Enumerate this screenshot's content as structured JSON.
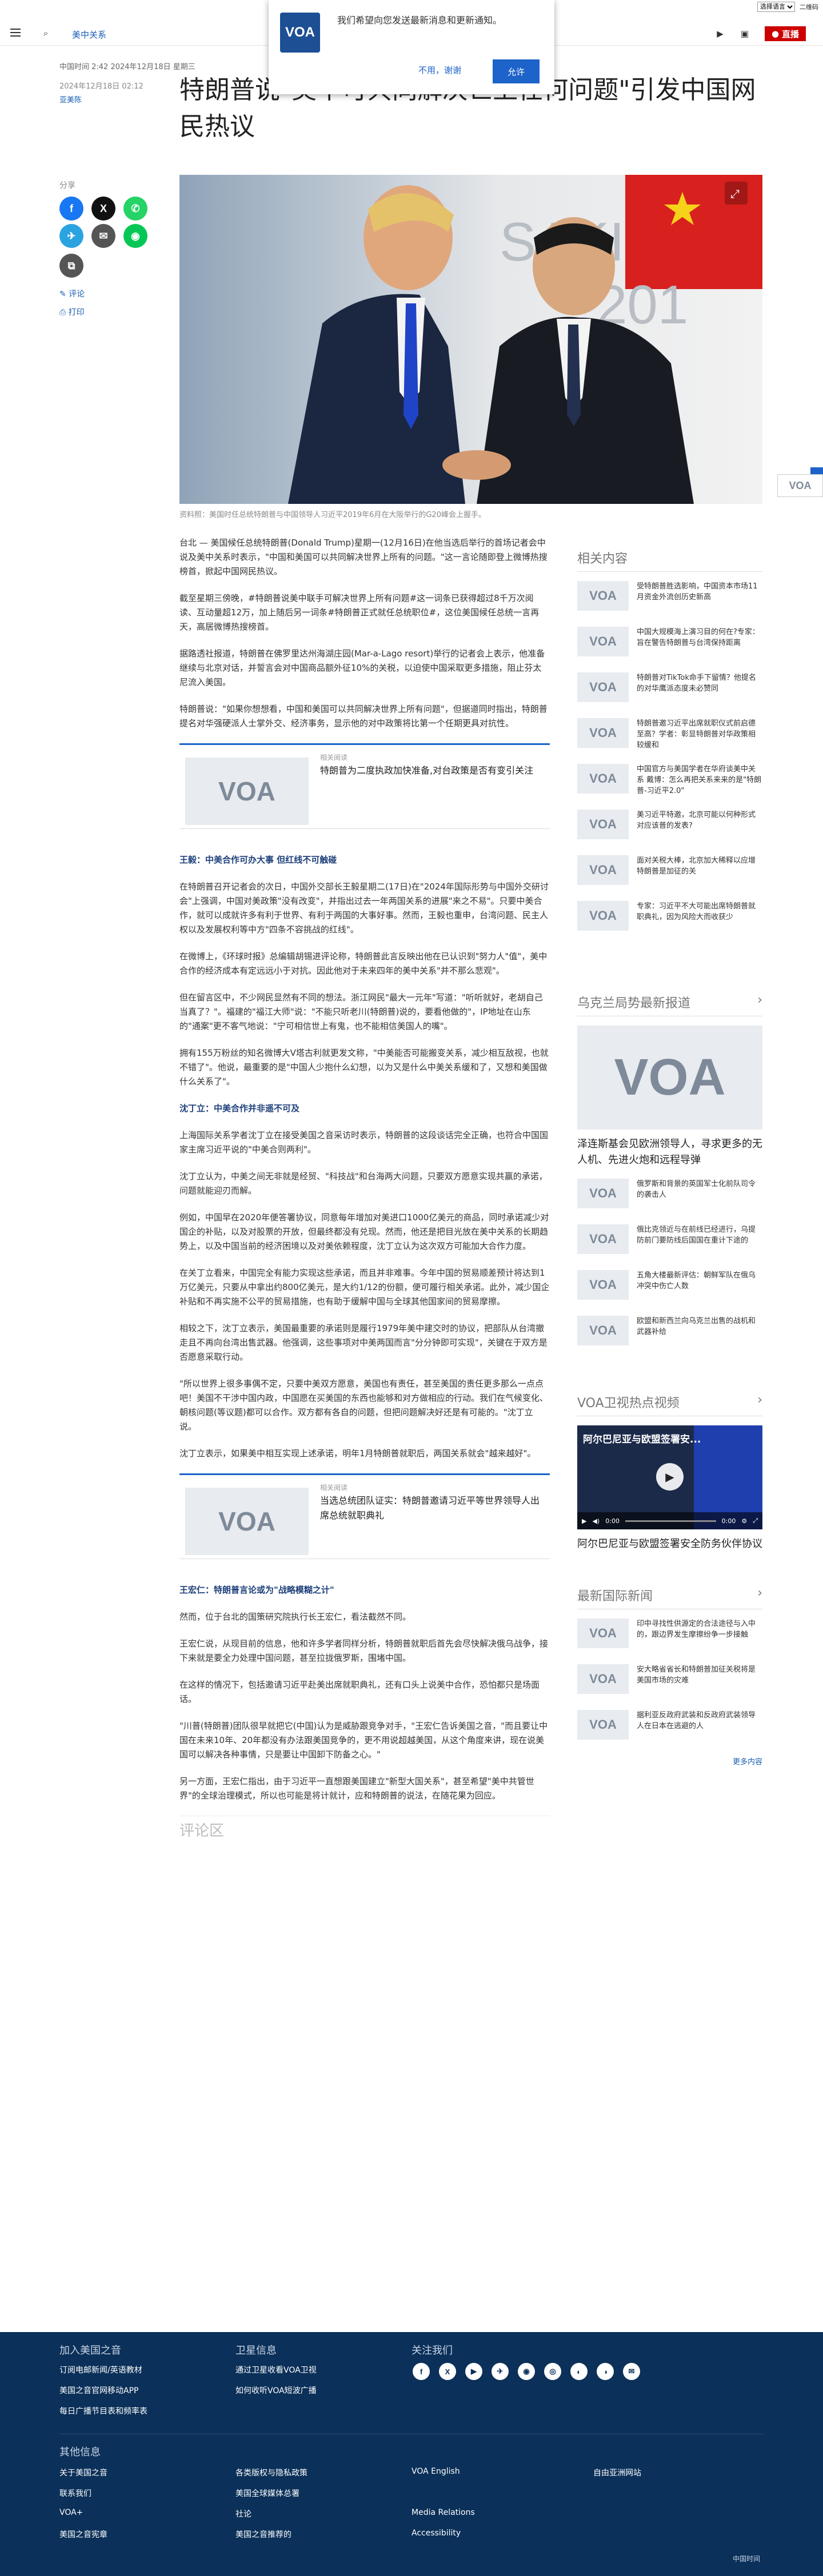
{
  "top": {
    "lang_select": "选择语言",
    "qr": "二维码",
    "site_name": "美国之音",
    "nav_section": "美中关系",
    "live_label": "直播"
  },
  "notification": {
    "logo": "VOA",
    "message": "我们希望向您发送最新消息和更新通知。",
    "decline": "不用，谢谢",
    "accept": "允许"
  },
  "meta": {
    "source": "中国时间 2:42 2024年12月18日 星期三",
    "date": "2024年12月18日 02:12",
    "author": "亚美陈"
  },
  "title": "特朗普说\"美中可共同解决世上任何问题\"引发中国网民热议",
  "share": {
    "label": "分享",
    "comment": "评论",
    "print": "打印"
  },
  "hero": {
    "sign_text": "SAKI",
    "sign_year": "201",
    "caption": "资料照：美国时任总统特朗普与中国领导人习近平2019年6月在大阪举行的G20峰会上握手。"
  },
  "article": {
    "p1": "台北 — 美国候任总统特朗普(Donald Trump)星期一(12月16日)在他当选后举行的首场记者会中说及美中关系时表示，\"中国和美国可以共同解决世界上所有的问题。\"这一言论随即登上微博热搜榜首，掀起中国网民热议。",
    "p2": "截至星期三傍晚，#特朗普说美中联手可解决世界上所有问题#这一词条已获得超过8千万次阅读、互动量超12万，加上随后另一词条#特朗普正式就任总统职位#，这位美国候任总统一言再天，高居微博热搜榜首。",
    "p3": "据路透社报道，特朗普在佛罗里达州海湖庄园(Mar-a-Lago resort)举行的记者会上表示，他准备继续与北京对话，并誓言会对中国商品额外征10%的关税，以迫使中国采取更多措施，阻止芬太尼流入美国。",
    "p4": "特朗普说：\"如果你想想看，中国和美国可以共同解决世界上所有问题\"，但据道同时指出，特朗普提名对华强硬派人士掌外交、经济事务，显示他的对中政策将比第一个任期更具对抗性。",
    "rel1_kicker": "相关阅读",
    "rel1_title": "特朗普为二度执政加快准备,对台政策是否有变引关注",
    "h1": "王毅：中美合作可办大事 但红线不可触碰",
    "p5": "在特朗普召开记者会的次日，中国外交部长王毅星期二(17日)在\"2024年国际形势与中国外交研讨会\"上强调，中国对美政策\"没有改变\"，并指出过去一年两国关系的进展\"来之不易\"。只要中美合作，就可以成就许多有利于世界、有利于两国的大事好事。然而，王毅也重申，台湾问题、民主人权以及发展权利等中方\"四条不容挑战的红线\"。",
    "p6": "在微博上，《环球时报》总编辑胡锡进评论称，特朗普此言反映出他在已认识到\"努力人\"值\"，美中合作的经济成本有定远远小于对抗。因此他对于未来四年的美中关系\"并不那么悲观\"。",
    "p7": "但在留言区中，不少网民显然有不同的想法。浙江网民\"最大一元年\"写道：\"听听就好，老胡自己当真了？\"。福建的\"福江大师\"说：\"不能只听老川(特朗普)说的，要看他做的\"，IP地址在山东的\"通案\"更不客气地说：\"宁可相信世上有鬼，也不能相信美国人的嘴\"。",
    "p8": "拥有155万粉丝的知名微博大V塔古利就更发文称，\"中美能否可能搬变关系，减少相互敌视，也就不错了\"。他说，最重要的是\"中国人少抱什么幻想，以为又是什么中美关系缓和了，又想和美国做什么关系了\"。",
    "h2": "沈丁立：中美合作并非遥不可及",
    "p9": "上海国际关系学者沈丁立在接受美国之音采访时表示，特朗普的这段谈话完全正确，也符合中国国家主席习近平说的\"中美合则两利\"。",
    "p10": "沈丁立认为，中美之间无非就是经贸、\"科技战\"和台海两大问题，只要双方愿意实现共赢的承诺，问题就能迎刃而解。",
    "p11": "例如，中国早在2020年便答署协议，同意每年增加对美进口1000亿美元的商品，同时承诺减少对国企的补贴，以及对股票的开放，但最终都没有兑现。然而，他还是把目光放在美中关系的长期趋势上，以及中国当前的经济困境以及对美依赖程度，沈丁立认为这次双方可能加大合作力度。",
    "p12": "在关丁立看来，中国完全有能力实现这些承诺，而且并非难事。今年中国的贸易顺差预计将达到1万亿美元，只要从中拿出约800亿美元，是大约1/12的份额，便可履行相关承诺。此外，减少国企补贴和不再实施不公平的贸易措施，也有助于缓解中国与全球其他国家间的贸易摩擦。",
    "p13": "相较之下，沈丁立表示，美国最重要的承诺则是履行1979年美中建交时的协议，把部队从台湾撤走且不再向台湾出售武器。他强调，这些事项对中美两国而言\"分分钟即可实现\"，关键在于双方是否愿意采取行动。",
    "p14": "\"所以世界上很多事偶不定，只要中美双方愿意，美国也有责任，甚至美国的责任更多那么一点点吧！美国不干涉中国内政，中国愿在买美国的东西也能够和对方做相应的行动。我们在气候变化、朝核问题(等议题)都可以合作。双方都有各自的问题，但把问题解决好还是有可能的。\"沈丁立说。",
    "p15": "沈丁立表示，如果美中相互实现上述承诺，明年1月特朗普就职后，两国关系就会\"越来越好\"。",
    "rel2_kicker": "相关阅读",
    "rel2_title": "当选总统团队证实：特朗普邀请习近平等世界领导人出席总统就职典礼",
    "h3": "王宏仁：特朗普言论或为\"战略模糊之计\"",
    "p16": "然而，位于台北的国策研究院执行长王宏仁，看法截然不同。",
    "p17": "王宏仁说，从现目前的信息，他和许多学者同样分析，特朗普就职后首先会尽快解决俄乌战争，接下来就是要全力处理中国问题，甚至拉拢俄罗斯，围堵中国。",
    "p18": "在这样的情况下，包括邀请习近平赴美出席就职典礼，还有口头上说美中合作，恐怕都只是场面话。",
    "p19": "\"川普(特朗普)团队很早就把它(中国)认为是威胁跟竞争对手，\"王宏仁告诉美国之音，\"而且要让中国在未来10年、20年都没有办法跟美国竞争的，更不用说超越美国，从这个角度来讲，现在说美国可以解决各种事情，只是要让中国卸下防备之心。\"",
    "p20": "另一方面，王宏仁指出，由于习近平一直想跟美国建立\"新型大国关系\"，甚至希望\"美中共管世界\"的全球治理模式，所以也可能是将计就计，应和特朗普的说法，在随花果为回应。"
  },
  "comments_label": "评论区",
  "sidebar": {
    "related_head": "相关内容",
    "related": [
      "受特朗普胜选影响，中国资本市场11月资金外流创历史新高",
      "中国大规模海上演习目的何在?专家：旨在警告特朗普与台湾保持距离",
      "特朗普对TikTok命手下留情？他提名的对华鹰派态度未必赞同",
      "特朗普邀习近平出席就职仪式前启德至高？学者：彰显特朗普对华政策相较缓和",
      "中国官方与美国学者在华府谈美中关系 戴博：怎么再把关系来来的是\"特朗普-习近平2.0\"",
      "美习近平特邀，北京可能以何种形式对应该普的发表?",
      "面对关税大棒，北京加大稀释以应增特朗普是加征的关",
      "专家：习近平不大可能出席特朗普就职典礼，因为风险大而收获少"
    ],
    "ukr_head": "乌克兰局势最新报道",
    "ukr_main": "泽连斯基会见欧洲领导人，寻求更多的无人机、先进火炮和远程导弹",
    "ukr_items": [
      "俄罗斯和背景的英国军士化前队司令的袭击人",
      "俄比克领近与在前线已经进行，乌提防前门要防线后国国在重计下途的",
      "五角大楼最新评估：朝鲜军队在俄乌冲突中伤亡人数",
      "欧盟和新西兰向乌克兰出售的战机和武器补给"
    ],
    "video_head": "VOA卫视热点视频",
    "video_title": "阿尔巴尼亚与欧盟签署安全防务伙伴协议",
    "video_overlay": "阿尔巴尼亚与欧盟签署安...",
    "video_time": "0:00",
    "video_dur": "0:00",
    "intl_head": "最新国际新闻",
    "intl_items": [
      "印中寻找性供源定的合法途径与入中的，跟边界发生摩擦纷争一步接触",
      "安大略省省长和特朗普加征关税将是美国市场的灾难",
      "据利亚反政府武装和反政府武装领导人在日本在逃避的人"
    ],
    "more": "更多内容"
  },
  "footer": {
    "about_head": "加入美国之音",
    "about_links": [
      "订阅电邮新闻/英语教材",
      "美国之音官网移动APP",
      "每日广播节目表和频率表"
    ],
    "sat_head": "卫星信息",
    "sat_links": [
      "通过卫星收看VOA卫视",
      "如何收听VOA短波广播"
    ],
    "follow_head": "关注我们",
    "social": [
      "f",
      "X",
      "▶",
      "✈",
      "◉",
      "◎",
      "◐",
      "◑",
      "✉"
    ],
    "other_head": "其他信息",
    "col1": [
      "关于美国之音",
      "联系我们",
      "VOA+",
      "美国之音宪章"
    ],
    "col2": [
      "各类版权与隐私政策",
      "美国全球媒体总署",
      "社论",
      "美国之音推荐的"
    ],
    "col3": [
      "VOA English",
      "",
      "Media Relations",
      "Accessibility"
    ],
    "col4": [
      "自由亚洲网站"
    ],
    "bottom": "中国时间"
  }
}
